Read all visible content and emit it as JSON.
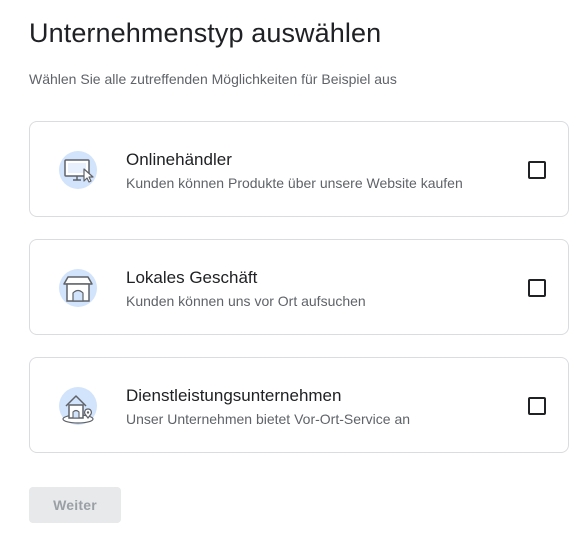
{
  "header": {
    "title": "Unternehmenstyp auswählen",
    "subtitle": "Wählen Sie alle zutreffenden Möglichkeiten für Beispiel aus"
  },
  "options": [
    {
      "title": "Onlinehändler",
      "description": "Kunden können Produkte über unsere Website kaufen",
      "icon": "monitor-cursor-icon",
      "checked": false
    },
    {
      "title": "Lokales Geschäft",
      "description": "Kunden können uns vor Ort aufsuchen",
      "icon": "storefront-icon",
      "checked": false
    },
    {
      "title": "Dienstleistungsunternehmen",
      "description": "Unser Unternehmen bietet Vor-Ort-Service an",
      "icon": "house-location-icon",
      "checked": false
    }
  ],
  "footer": {
    "next_label": "Weiter",
    "next_enabled": false
  },
  "colors": {
    "icon_circle": "#d2e3fc",
    "icon_stroke": "#5f6368",
    "border": "#dadce0",
    "disabled_button_bg": "#e8e9eb"
  }
}
